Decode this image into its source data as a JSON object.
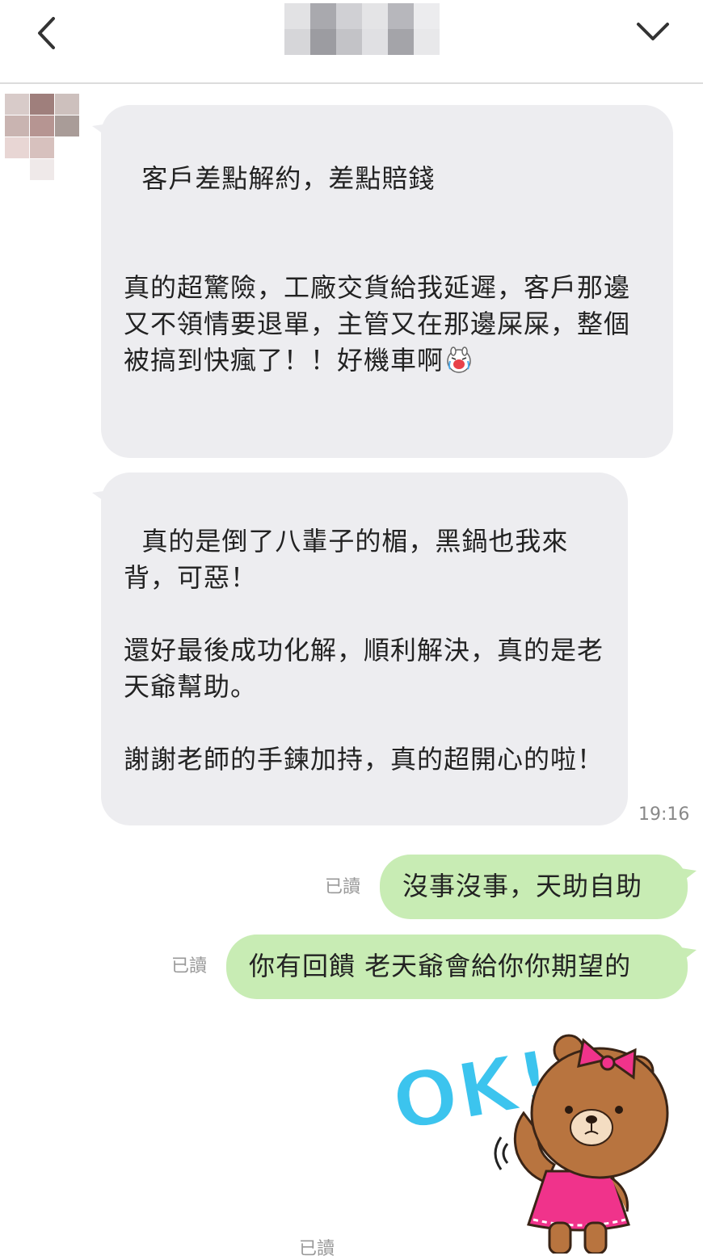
{
  "header": {
    "back_icon": "chevron-left-icon",
    "menu_icon": "chevron-down-icon",
    "title_blur_colors": [
      "#e2e2e4",
      "#a9a9ae",
      "#d0d0d4",
      "#e4e4e6",
      "#b7b7bc",
      "#ececee",
      "#d6d6d9",
      "#9c9ca1",
      "#c3c3c7",
      "#e0e0e3",
      "#a4a4a9",
      "#e8e8ea"
    ]
  },
  "contact": {
    "avatar_blur_colors": [
      "#d8cbc9",
      "#9f7f7c",
      "#cdc0bd",
      "#c9b4b1",
      "#b69592",
      "#a99c98",
      "#e8d6d4",
      "#d7c1be",
      "#ffffff",
      "#ffffff",
      "#efe9e9",
      "#ffffff"
    ]
  },
  "messages": [
    {
      "text": "客戶差點解約，差點賠錢\n\n\n真的超驚險，工廠交貨給我延遲，客戶那邊又不領情要退單，主管又在那邊屎屎，整個被搞到快瘋了！！好機車啊",
      "emoji": "crying-face-icon"
    },
    {
      "text": "真的是倒了八輩子的楣，黑鍋也我來背，可惡！\n\n還好最後成功化解，順利解決，真的是老天爺幫助。\n\n謝謝老師的手鍊加持，真的超開心的啦！",
      "time": "19:16"
    },
    {
      "text": "沒事沒事，天助自助",
      "read": "已讀"
    },
    {
      "text": "你有回饋 老天爺會給你你期望的",
      "read": "已讀"
    },
    {
      "sticker": "brown-bear-ok-sticker",
      "sticker_text": "OK!",
      "read": "已讀"
    }
  ],
  "colors": {
    "incoming_bubble": "#ededf0",
    "outgoing_bubble": "#c8ecb4",
    "sticker_ok": "#3cc4ee",
    "sticker_bear": "#b8743f",
    "sticker_dress": "#f0338b"
  }
}
